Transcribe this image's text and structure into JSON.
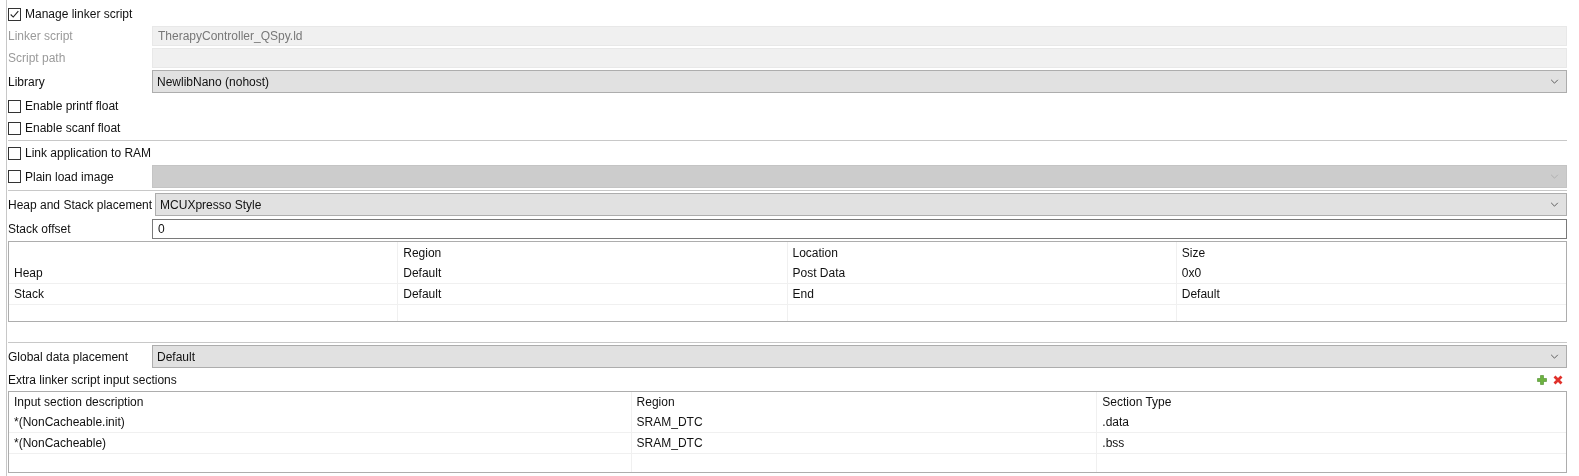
{
  "sections": [
    [
      {
        "kind": "checkbox",
        "label": "Manage linker script",
        "checked": true
      },
      {
        "kind": "field",
        "label": "Linker script",
        "value": "TherapyController_QSpy.ld",
        "disabled": true
      },
      {
        "kind": "field",
        "label": "Script path",
        "disabled": true
      },
      {
        "kind": "combo",
        "label": "Library",
        "value": "NewlibNano (nohost)",
        "disabled": false
      },
      {
        "kind": "checkbox",
        "label": "Enable printf float",
        "checked": false
      },
      {
        "kind": "checkbox",
        "label": "Enable scanf float",
        "checked": false
      }
    ],
    [
      {
        "kind": "checkbox",
        "label": "Link application to RAM",
        "checked": false
      },
      {
        "kind": "checkbox_combo",
        "label": "Plain load image",
        "checked": false,
        "disabled": true
      }
    ],
    [
      {
        "kind": "combo",
        "label": "Heap and Stack placement",
        "value": "MCUXpresso Style",
        "disabled": false
      },
      {
        "kind": "field",
        "label": "Stack offset",
        "value": "0",
        "disabled": false
      },
      {
        "kind": "heap_table",
        "columns": [
          "Region",
          "Location",
          "Size"
        ],
        "rows": [
          {
            "name": "Heap",
            "region": "Default",
            "location": "Post Data",
            "size": "0x0"
          },
          {
            "name": "Stack",
            "region": "Default",
            "location": "End",
            "size": "Default"
          }
        ]
      }
    ],
    [
      {
        "kind": "combo",
        "label": "Global data placement",
        "value": "Default",
        "disabled": false
      },
      {
        "kind": "heading",
        "label": "Extra linker script input sections"
      },
      {
        "kind": "sections_table",
        "columns": [
          "Input section description",
          "Region",
          "Section Type"
        ],
        "rows": [
          {
            "description": "*(NonCacheable.init)",
            "region": "SRAM_DTC",
            "type": ".data"
          },
          {
            "description": "*(NonCacheable)",
            "region": "SRAM_DTC",
            "type": ".bss"
          }
        ]
      }
    ]
  ]
}
